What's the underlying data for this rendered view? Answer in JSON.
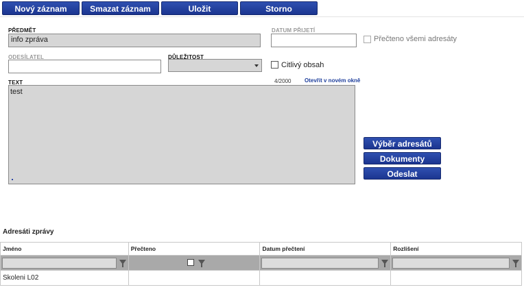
{
  "toolbar": {
    "new_label": "Nový záznam",
    "delete_label": "Smazat záznam",
    "save_label": "Uložit",
    "cancel_label": "Storno"
  },
  "form": {
    "subject_label": "PŘEDMĚT",
    "subject_value": "info zpráva",
    "received_label": "DATUM PŘIJETÍ",
    "received_value": "",
    "read_all_label": "Přečteno všemi adresáty",
    "sender_label": "ODESÍLATEL",
    "sender_value": "",
    "importance_label": "DŮLEŽITOST",
    "importance_value": "",
    "sensitive_label": "Citlivý obsah",
    "text_label": "TEXT",
    "text_counter": "4/2000",
    "open_new_window": "Otevřít v novém okně",
    "text_value": "test"
  },
  "actions": {
    "select_recipients": "Výběr adresátů",
    "documents": "Dokumenty",
    "send": "Odeslat"
  },
  "recipients": {
    "title": "Adresáti zprávy",
    "columns": [
      "Jméno",
      "Přečteno",
      "Datum přečtení",
      "Rozlišení"
    ],
    "rows": [
      [
        "Skoleni L02",
        "",
        "",
        ""
      ]
    ]
  }
}
